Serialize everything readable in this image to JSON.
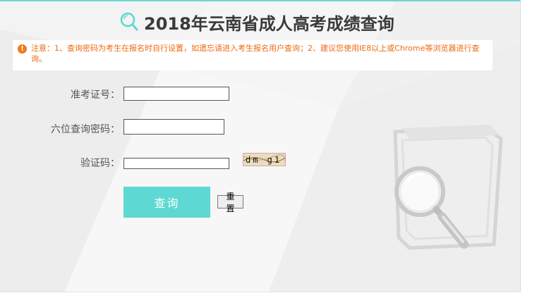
{
  "header": {
    "title": "2018年云南省成人高考成绩查询"
  },
  "notice": {
    "icon": "exclamation-icon",
    "text": "注意：1、查询密码为考生在报名时自行设置，如遗忘请进入考生报名用户查询；2、建议您使用IE8以上或Chrome等浏览器进行查询。"
  },
  "form": {
    "exam_id_label": "准考证号：",
    "exam_id_value": "",
    "password_label": "六位查询密码：",
    "password_value": "",
    "captcha_label": "验证码：",
    "captcha_value": "",
    "captcha_image_text": "dm g1",
    "submit_label": "查询",
    "reset_label": "重置"
  },
  "colors": {
    "accent": "#5ed8d2",
    "notice": "#ee6a0e",
    "title": "#3a3a3a"
  }
}
